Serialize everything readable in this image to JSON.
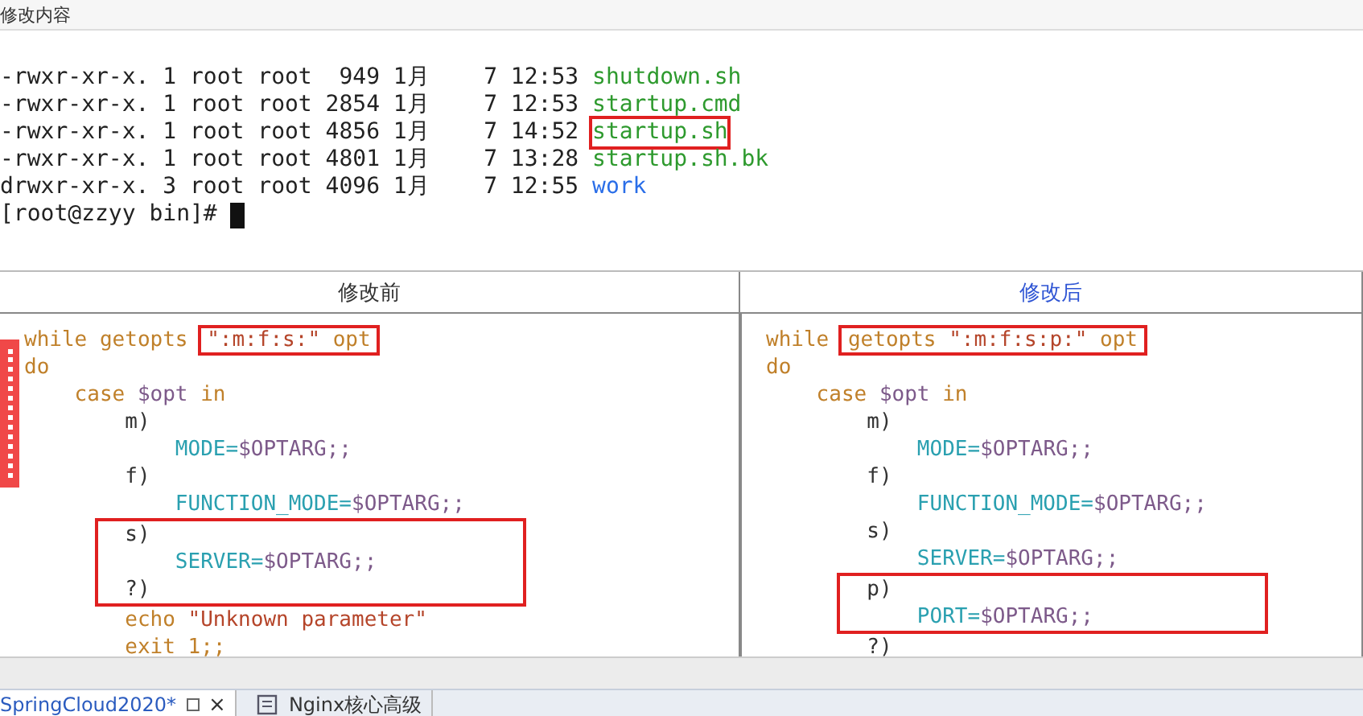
{
  "header": {
    "title": "修改内容"
  },
  "terminal": {
    "lines": [
      {
        "info": "-rwxr-xr-x. 1 root root  949 1月    7 12:53 ",
        "file": "shutdown.sh",
        "color": "#2e9a2e"
      },
      {
        "info": "-rwxr-xr-x. 1 root root 2854 1月    7 12:53 ",
        "file": "startup.cmd",
        "color": "#2e9a2e"
      },
      {
        "info": "-rwxr-xr-x. 1 root root 4856 1月    7 14:52 ",
        "file": "startup.sh",
        "color": "#2e9a2e",
        "boxed": true
      },
      {
        "info": "-rwxr-xr-x. 1 root root 4801 1月    7 13:28 ",
        "file": "startup.sh.bk",
        "color": "#2e9a2e"
      },
      {
        "info": "drwxr-xr-x. 3 root root 4096 1月    7 12:55 ",
        "file": "work",
        "color": "#2a6ee8"
      }
    ],
    "prompt": "[root@zzyy bin]#"
  },
  "table": {
    "columns": [
      {
        "title": "修改前",
        "selected": false
      },
      {
        "title": "修改后",
        "selected": true
      }
    ],
    "panels": [
      {
        "lines": [
          {
            "parts": [
              {
                "text": "while getopts ",
                "kind": "kw"
              },
              {
                "text": "\":m:f:s:\"",
                "kind": "str",
                "boxed": true
              },
              {
                "text": " opt",
                "kind": "kw",
                "boxed": true
              }
            ]
          },
          {
            "parts": [
              {
                "text": "do",
                "kind": "kw"
              }
            ]
          },
          {
            "parts": [
              {
                "text": "    case ",
                "kind": "kw"
              },
              {
                "text": "$opt",
                "kind": "arg"
              },
              {
                "text": " in",
                "kind": "kw"
              }
            ]
          },
          {
            "parts": [
              {
                "text": "        m)",
                "kind": "plain"
              }
            ]
          },
          {
            "parts": [
              {
                "text": "            MODE=",
                "kind": "var"
              },
              {
                "text": "$OPTARG;;",
                "kind": "arg"
              }
            ]
          },
          {
            "parts": [
              {
                "text": "        f)",
                "kind": "plain"
              }
            ]
          },
          {
            "parts": [
              {
                "text": "            FUNCTION_MODE=",
                "kind": "var"
              },
              {
                "text": "$OPTARG;;",
                "kind": "arg"
              }
            ]
          },
          {
            "boxed": true,
            "parts": [
              {
                "text": "        s)",
                "kind": "plain"
              }
            ]
          },
          {
            "boxed": true,
            "parts": [
              {
                "text": "            SERVER=",
                "kind": "var"
              },
              {
                "text": "$OPTARG;;",
                "kind": "arg"
              }
            ]
          },
          {
            "boxed": true,
            "parts": [
              {
                "text": "        ?)",
                "kind": "plain"
              }
            ]
          },
          {
            "parts": [
              {
                "text": "        echo ",
                "kind": "kw"
              },
              {
                "text": "\"Unknown parameter\"",
                "kind": "str"
              }
            ]
          },
          {
            "parts": [
              {
                "text": "        exit 1;;",
                "kind": "kw"
              }
            ]
          }
        ]
      },
      {
        "lines": [
          {
            "parts": [
              {
                "text": "while ",
                "kind": "kw"
              },
              {
                "text": "getopts ",
                "kind": "kw",
                "boxed": true
              },
              {
                "text": "\":m:f:s:p:\"",
                "kind": "str",
                "boxed": true
              },
              {
                "text": " opt",
                "kind": "kw",
                "boxed": true
              }
            ]
          },
          {
            "parts": [
              {
                "text": "do",
                "kind": "kw"
              }
            ]
          },
          {
            "parts": [
              {
                "text": "    case ",
                "kind": "kw"
              },
              {
                "text": "$opt",
                "kind": "arg"
              },
              {
                "text": " in",
                "kind": "kw"
              }
            ]
          },
          {
            "parts": [
              {
                "text": "        m)",
                "kind": "plain"
              }
            ]
          },
          {
            "parts": [
              {
                "text": "            MODE=",
                "kind": "var"
              },
              {
                "text": "$OPTARG;;",
                "kind": "arg"
              }
            ]
          },
          {
            "parts": [
              {
                "text": "        f)",
                "kind": "plain"
              }
            ]
          },
          {
            "parts": [
              {
                "text": "            FUNCTION_MODE=",
                "kind": "var"
              },
              {
                "text": "$OPTARG;;",
                "kind": "arg"
              }
            ]
          },
          {
            "parts": [
              {
                "text": "        s)",
                "kind": "plain"
              }
            ]
          },
          {
            "parts": [
              {
                "text": "            SERVER=",
                "kind": "var"
              },
              {
                "text": "$OPTARG;;",
                "kind": "arg"
              }
            ]
          },
          {
            "boxed": true,
            "parts": [
              {
                "text": "        p)",
                "kind": "plain"
              }
            ]
          },
          {
            "boxed": true,
            "parts": [
              {
                "text": "            PORT=",
                "kind": "var"
              },
              {
                "text": "$OPTARG;;",
                "kind": "arg"
              }
            ]
          },
          {
            "parts": [
              {
                "text": "        ?)",
                "kind": "plain"
              }
            ]
          }
        ]
      }
    ]
  },
  "tabs": [
    {
      "label": "SpringCloud2020*",
      "selected": true,
      "close": "×"
    },
    {
      "label": "Nginx核心高级",
      "selected": false
    }
  ]
}
